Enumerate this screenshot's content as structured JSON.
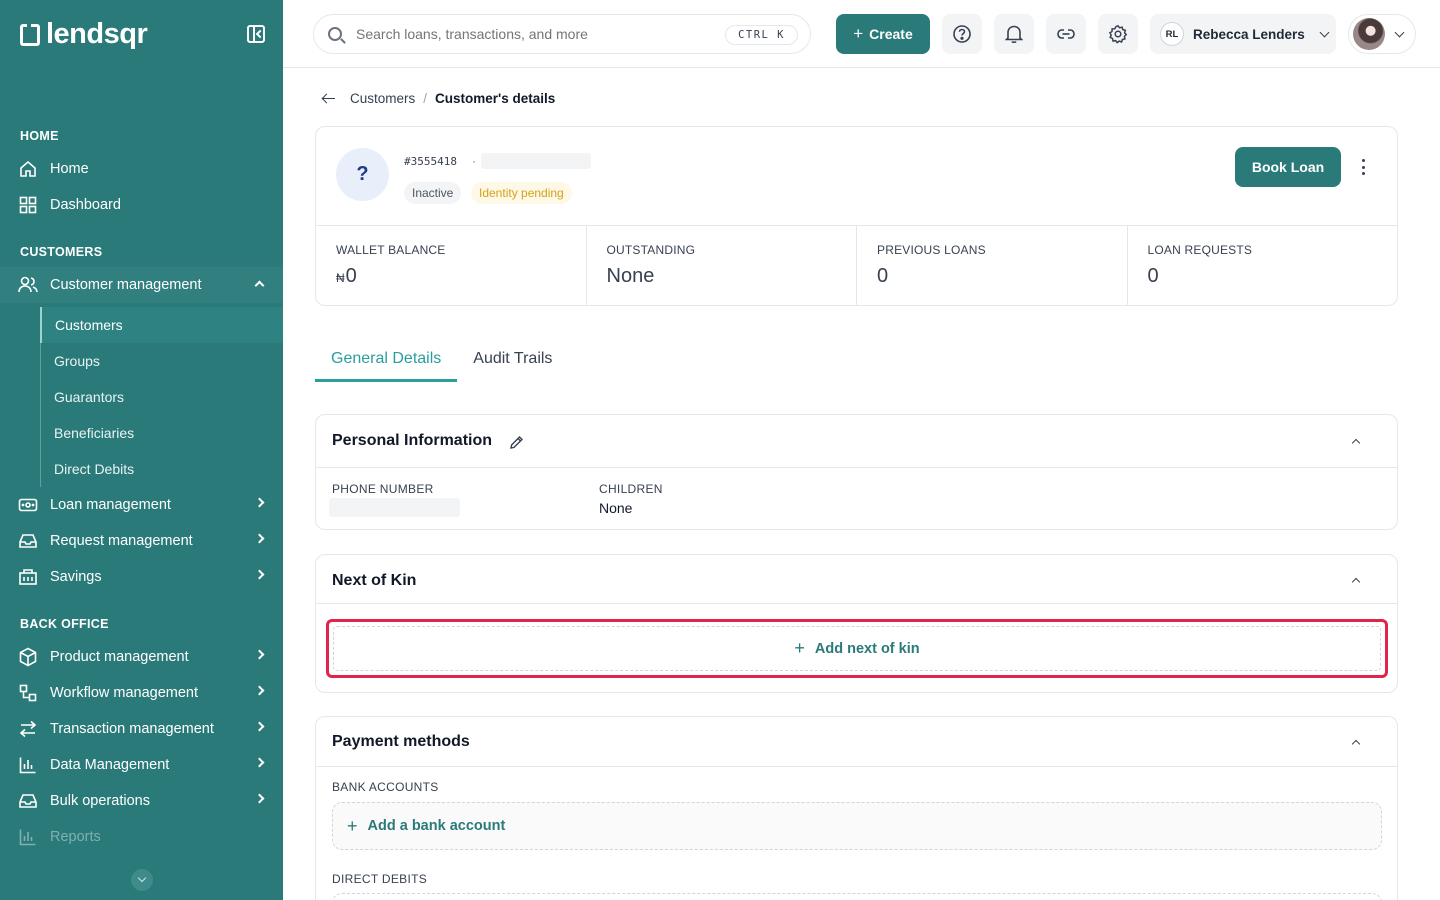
{
  "brand": {
    "name": "lendsqr"
  },
  "sidebar": {
    "sections": {
      "home": "HOME",
      "customers": "CUSTOMERS",
      "back_office": "BACK OFFICE"
    },
    "home_items": [
      "Home",
      "Dashboard"
    ],
    "customer_management": {
      "label": "Customer management",
      "expanded": true,
      "subitems": [
        "Customers",
        "Groups",
        "Guarantors",
        "Beneficiaries",
        "Direct Debits"
      ],
      "active_subitem": "Customers"
    },
    "customer_items": [
      "Loan management",
      "Request management",
      "Savings"
    ],
    "back_office_items": [
      "Product management",
      "Workflow management",
      "Transaction management",
      "Data Management",
      "Bulk operations",
      "Reports"
    ]
  },
  "topbar": {
    "search_placeholder": "Search loans, transactions, and more",
    "shortcut": "CTRL K",
    "create_label": "Create",
    "user_initials": "RL",
    "user_name": "Rebecca Lenders"
  },
  "breadcrumb": {
    "parent": "Customers",
    "separator": "/",
    "current": "Customer's details"
  },
  "customer": {
    "avatar_glyph": "?",
    "id": "#3555418",
    "id_separator": "·",
    "status": "Inactive",
    "identity_status": "Identity pending",
    "book_loan_label": "Book Loan"
  },
  "stats": [
    {
      "label": "WALLET BALANCE",
      "currency": "₦",
      "value": "0"
    },
    {
      "label": "OUTSTANDING",
      "currency": "",
      "value": "None"
    },
    {
      "label": "PREVIOUS LOANS",
      "currency": "",
      "value": "0"
    },
    {
      "label": "LOAN REQUESTS",
      "currency": "",
      "value": "0"
    }
  ],
  "tabs": [
    {
      "label": "General Details",
      "active": true
    },
    {
      "label": "Audit Trails",
      "active": false
    }
  ],
  "personal_information": {
    "title": "Personal Information",
    "fields": [
      {
        "label": "PHONE NUMBER",
        "value": ""
      },
      {
        "label": "CHILDREN",
        "value": "None"
      }
    ]
  },
  "next_of_kin": {
    "title": "Next of Kin",
    "add_label": "Add next of kin"
  },
  "payment_methods": {
    "title": "Payment methods",
    "bank_accounts_label": "BANK ACCOUNTS",
    "add_bank_label": "Add a bank account",
    "direct_debits_label": "DIRECT DEBITS"
  },
  "colors": {
    "brand": "#2a7a7a",
    "accent_tab": "#2a9d9d",
    "highlight": "#e0244a",
    "pending": "#d4a017"
  },
  "icons": [
    "panel-collapse-icon",
    "home-icon",
    "dashboard-icon",
    "users-icon",
    "loan-icon",
    "inbox-icon",
    "savings-icon",
    "product-icon",
    "workflow-icon",
    "transfer-icon",
    "chart-icon",
    "bulk-icon",
    "reports-icon",
    "search-icon",
    "plus-icon",
    "help-icon",
    "bell-icon",
    "link-icon",
    "gear-icon",
    "chevron-down-icon",
    "back-arrow-icon",
    "pencil-icon",
    "kebab-icon"
  ]
}
